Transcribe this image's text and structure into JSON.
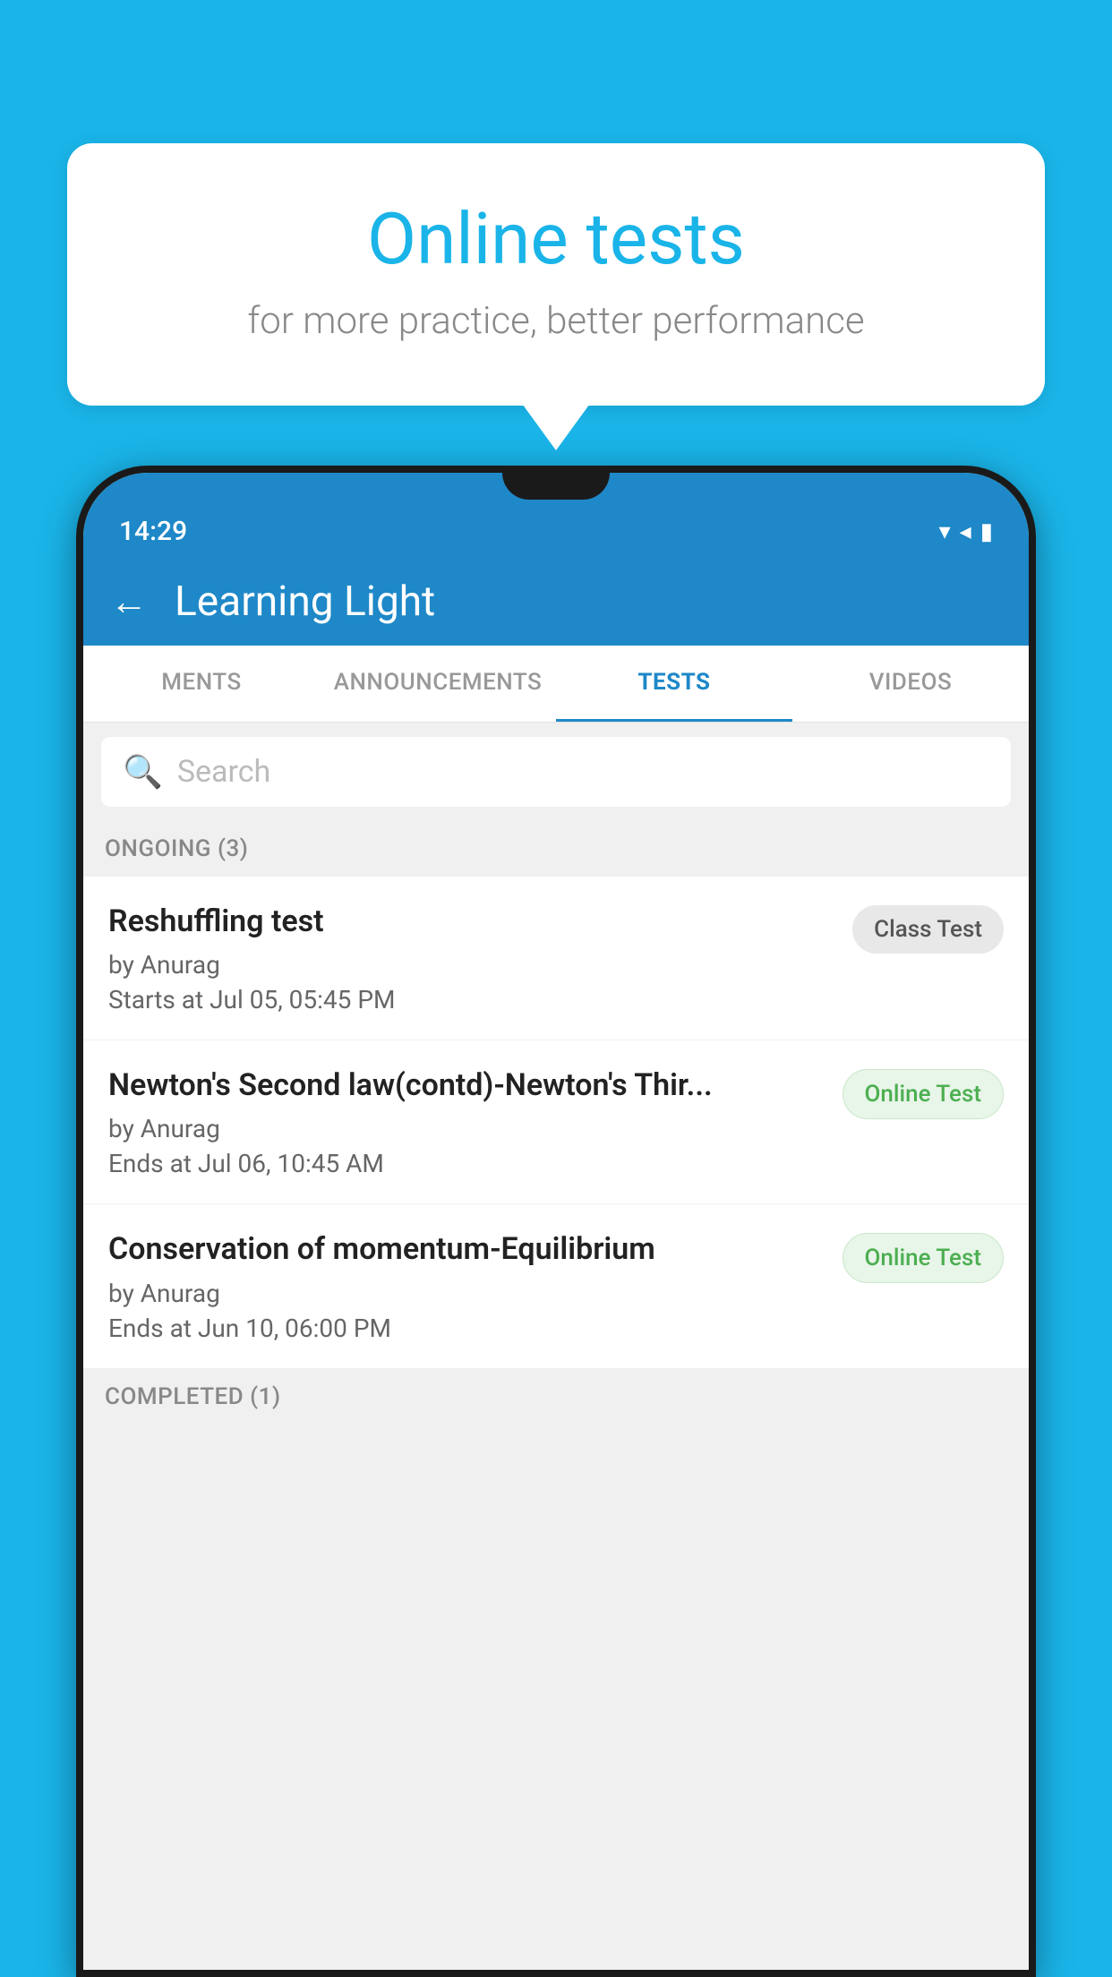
{
  "background_color": "#1ab4e8",
  "speech_bubble": {
    "title": "Online tests",
    "subtitle": "for more practice, better performance"
  },
  "status_bar": {
    "time": "14:29",
    "icons": [
      "wifi",
      "signal",
      "battery"
    ]
  },
  "app_header": {
    "back_label": "←",
    "title": "Learning Light"
  },
  "tabs": [
    {
      "label": "MENTS",
      "active": false
    },
    {
      "label": "ANNOUNCEMENTS",
      "active": false
    },
    {
      "label": "TESTS",
      "active": true
    },
    {
      "label": "VIDEOS",
      "active": false
    }
  ],
  "search": {
    "placeholder": "Search"
  },
  "ongoing_section": {
    "label": "ONGOING (3)"
  },
  "tests": [
    {
      "title": "Reshuffling test",
      "author": "by Anurag",
      "date_label": "Starts at",
      "date": "Jul 05, 05:45 PM",
      "badge": "Class Test",
      "badge_type": "class"
    },
    {
      "title": "Newton's Second law(contd)-Newton's Thir...",
      "author": "by Anurag",
      "date_label": "Ends at",
      "date": "Jul 06, 10:45 AM",
      "badge": "Online Test",
      "badge_type": "online"
    },
    {
      "title": "Conservation of momentum-Equilibrium",
      "author": "by Anurag",
      "date_label": "Ends at",
      "date": "Jun 10, 06:00 PM",
      "badge": "Online Test",
      "badge_type": "online"
    }
  ],
  "completed_section": {
    "label": "COMPLETED (1)"
  }
}
